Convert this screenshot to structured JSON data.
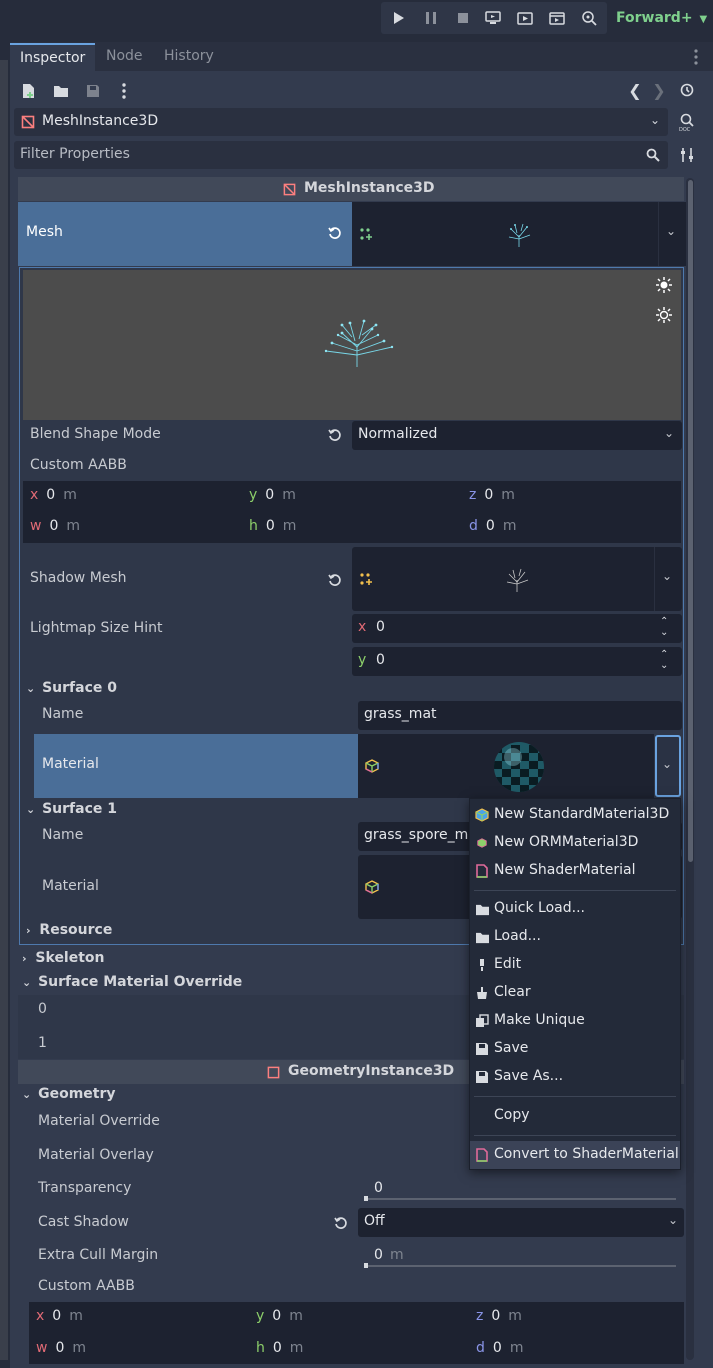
{
  "toolbar": {
    "renderer_label": "Forward+"
  },
  "tabs": [
    {
      "label": "Inspector"
    },
    {
      "label": "Node"
    },
    {
      "label": "History"
    }
  ],
  "inspector": {
    "node_type": "MeshInstance3D",
    "filter_placeholder": "Filter Properties",
    "section_mesh_instance": "MeshInstance3D",
    "section_geometry_instance": "GeometryInstance3D"
  },
  "mesh": {
    "label": "Mesh",
    "blend_shape_label": "Blend Shape Mode",
    "blend_shape_value": "Normalized",
    "custom_aabb_label": "Custom AABB",
    "aabb": {
      "x": "0",
      "y": "0",
      "z": "0",
      "w": "0",
      "h": "0",
      "d": "0",
      "unit": "m",
      "x_label": "x",
      "y_label": "y",
      "z_label": "z",
      "w_label": "w",
      "h_label": "h",
      "d_label": "d"
    },
    "shadow_mesh_label": "Shadow Mesh",
    "lightmap_label": "Lightmap Size Hint",
    "lightmap_x": "0",
    "lightmap_y": "0",
    "surface0": {
      "title": "Surface 0",
      "name_label": "Name",
      "name_value": "grass_mat",
      "material_label": "Material"
    },
    "surface1": {
      "title": "Surface 1",
      "name_label": "Name",
      "name_value": "grass_spore_ma",
      "material_label": "Material"
    },
    "resource_label": "Resource"
  },
  "skeleton_label": "Skeleton",
  "surface_override": {
    "title": "Surface Material Override",
    "row0": "0",
    "row1": "1"
  },
  "geometry": {
    "title": "Geometry",
    "material_override": "Material Override",
    "material_overlay": "Material Overlay",
    "transparency_label": "Transparency",
    "transparency_value": "0",
    "transparency_fraction": 0,
    "cast_shadow_label": "Cast Shadow",
    "cast_shadow_value": "Off",
    "extra_cull_label": "Extra Cull Margin",
    "extra_cull_value": "0",
    "extra_cull_unit": "m",
    "custom_aabb_label": "Custom AABB",
    "aabb": {
      "x": "0",
      "y": "0",
      "z": "0",
      "w": "0",
      "h": "0",
      "d": "0",
      "unit": "m"
    }
  },
  "context_menu": {
    "items": [
      {
        "label": "New StandardMaterial3D",
        "icon": "standard-material-icon"
      },
      {
        "label": "New ORMMaterial3D",
        "icon": "orm-material-icon"
      },
      {
        "label": "New ShaderMaterial",
        "icon": "shader-material-icon"
      },
      {
        "label": "Quick Load...",
        "icon": "folder-icon"
      },
      {
        "label": "Load...",
        "icon": "folder-icon"
      },
      {
        "label": "Edit",
        "icon": "edit-icon"
      },
      {
        "label": "Clear",
        "icon": "clear-icon"
      },
      {
        "label": "Make Unique",
        "icon": "duplicate-icon"
      },
      {
        "label": "Save",
        "icon": "save-icon"
      },
      {
        "label": "Save As...",
        "icon": "save-icon"
      },
      {
        "label": "Copy",
        "icon": ""
      },
      {
        "label": "Convert to ShaderMaterial",
        "icon": "shader-material-icon"
      }
    ]
  },
  "colors": {
    "accent": "#4a6e98",
    "panel": "#262c3b",
    "field": "#1d2230",
    "highlight_border": "#4e79ad",
    "green_accent": "#7fd08d"
  }
}
